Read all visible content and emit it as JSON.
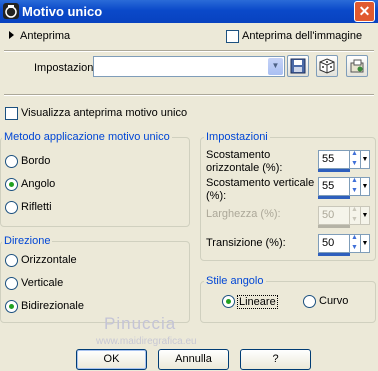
{
  "window": {
    "title": "Motivo unico",
    "close_glyph": "✕"
  },
  "preview_toggle": {
    "label": "Anteprima",
    "icon": "triangle-right-icon"
  },
  "image_preview": {
    "label": "Anteprima dell'immagine",
    "checked": false
  },
  "settings": {
    "label": "Impostazioni",
    "value": ""
  },
  "preview_single": {
    "label": "Visualizza anteprima motivo unico",
    "checked": false
  },
  "method_group": {
    "title": "Metodo applicazione motivo unico",
    "options": [
      {
        "label": "Bordo",
        "selected": false
      },
      {
        "label": "Angolo",
        "selected": true
      },
      {
        "label": "Rifletti",
        "selected": false
      }
    ]
  },
  "direction_group": {
    "title": "Direzione",
    "options": [
      {
        "label": "Orizzontale",
        "selected": false
      },
      {
        "label": "Verticale",
        "selected": false
      },
      {
        "label": "Bidirezionale",
        "selected": true
      }
    ]
  },
  "settings_group": {
    "title": "Impostazioni",
    "fields": [
      {
        "label_1": "Scostamento",
        "label_2": "orizzontale (%):",
        "value": "55",
        "enabled": true
      },
      {
        "label_1": "Scostamento verticale",
        "label_2": "(%):",
        "value": "55",
        "enabled": true
      },
      {
        "label_1": "Larghezza (%):",
        "value": "50",
        "enabled": false
      },
      {
        "label_1": "Transizione (%):",
        "value": "50",
        "enabled": true
      }
    ]
  },
  "corner_group": {
    "title": "Stile angolo",
    "options": [
      {
        "label": "Lineare",
        "selected": true
      },
      {
        "label": "Curvo",
        "selected": false
      }
    ]
  },
  "buttons": {
    "ok": "OK",
    "cancel": "Annulla",
    "help": "?"
  },
  "watermark": {
    "name": "Pinuccia",
    "url": "www.maidiregrafica.eu"
  },
  "colors": {
    "title_bar": "#0842c0",
    "group_title": "#0046d5",
    "background": "#ece9d8",
    "radio_dot": "#21a121"
  }
}
